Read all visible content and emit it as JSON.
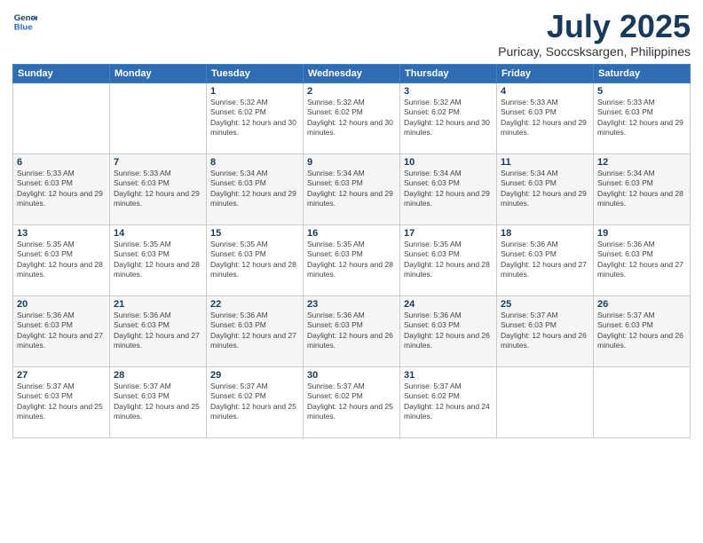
{
  "logo": {
    "line1": "General",
    "line2": "Blue"
  },
  "header": {
    "title": "July 2025",
    "subtitle": "Puricay, Soccsksargen, Philippines"
  },
  "weekdays": [
    "Sunday",
    "Monday",
    "Tuesday",
    "Wednesday",
    "Thursday",
    "Friday",
    "Saturday"
  ],
  "weeks": [
    [
      {
        "day": "",
        "info": ""
      },
      {
        "day": "",
        "info": ""
      },
      {
        "day": "1",
        "info": "Sunrise: 5:32 AM\nSunset: 6:02 PM\nDaylight: 12 hours and 30 minutes."
      },
      {
        "day": "2",
        "info": "Sunrise: 5:32 AM\nSunset: 6:02 PM\nDaylight: 12 hours and 30 minutes."
      },
      {
        "day": "3",
        "info": "Sunrise: 5:32 AM\nSunset: 6:02 PM\nDaylight: 12 hours and 30 minutes."
      },
      {
        "day": "4",
        "info": "Sunrise: 5:33 AM\nSunset: 6:03 PM\nDaylight: 12 hours and 29 minutes."
      },
      {
        "day": "5",
        "info": "Sunrise: 5:33 AM\nSunset: 6:03 PM\nDaylight: 12 hours and 29 minutes."
      }
    ],
    [
      {
        "day": "6",
        "info": "Sunrise: 5:33 AM\nSunset: 6:03 PM\nDaylight: 12 hours and 29 minutes."
      },
      {
        "day": "7",
        "info": "Sunrise: 5:33 AM\nSunset: 6:03 PM\nDaylight: 12 hours and 29 minutes."
      },
      {
        "day": "8",
        "info": "Sunrise: 5:34 AM\nSunset: 6:03 PM\nDaylight: 12 hours and 29 minutes."
      },
      {
        "day": "9",
        "info": "Sunrise: 5:34 AM\nSunset: 6:03 PM\nDaylight: 12 hours and 29 minutes."
      },
      {
        "day": "10",
        "info": "Sunrise: 5:34 AM\nSunset: 6:03 PM\nDaylight: 12 hours and 29 minutes."
      },
      {
        "day": "11",
        "info": "Sunrise: 5:34 AM\nSunset: 6:03 PM\nDaylight: 12 hours and 29 minutes."
      },
      {
        "day": "12",
        "info": "Sunrise: 5:34 AM\nSunset: 6:03 PM\nDaylight: 12 hours and 28 minutes."
      }
    ],
    [
      {
        "day": "13",
        "info": "Sunrise: 5:35 AM\nSunset: 6:03 PM\nDaylight: 12 hours and 28 minutes."
      },
      {
        "day": "14",
        "info": "Sunrise: 5:35 AM\nSunset: 6:03 PM\nDaylight: 12 hours and 28 minutes."
      },
      {
        "day": "15",
        "info": "Sunrise: 5:35 AM\nSunset: 6:03 PM\nDaylight: 12 hours and 28 minutes."
      },
      {
        "day": "16",
        "info": "Sunrise: 5:35 AM\nSunset: 6:03 PM\nDaylight: 12 hours and 28 minutes."
      },
      {
        "day": "17",
        "info": "Sunrise: 5:35 AM\nSunset: 6:03 PM\nDaylight: 12 hours and 28 minutes."
      },
      {
        "day": "18",
        "info": "Sunrise: 5:36 AM\nSunset: 6:03 PM\nDaylight: 12 hours and 27 minutes."
      },
      {
        "day": "19",
        "info": "Sunrise: 5:36 AM\nSunset: 6:03 PM\nDaylight: 12 hours and 27 minutes."
      }
    ],
    [
      {
        "day": "20",
        "info": "Sunrise: 5:36 AM\nSunset: 6:03 PM\nDaylight: 12 hours and 27 minutes."
      },
      {
        "day": "21",
        "info": "Sunrise: 5:36 AM\nSunset: 6:03 PM\nDaylight: 12 hours and 27 minutes."
      },
      {
        "day": "22",
        "info": "Sunrise: 5:36 AM\nSunset: 6:03 PM\nDaylight: 12 hours and 27 minutes."
      },
      {
        "day": "23",
        "info": "Sunrise: 5:36 AM\nSunset: 6:03 PM\nDaylight: 12 hours and 26 minutes."
      },
      {
        "day": "24",
        "info": "Sunrise: 5:36 AM\nSunset: 6:03 PM\nDaylight: 12 hours and 26 minutes."
      },
      {
        "day": "25",
        "info": "Sunrise: 5:37 AM\nSunset: 6:03 PM\nDaylight: 12 hours and 26 minutes."
      },
      {
        "day": "26",
        "info": "Sunrise: 5:37 AM\nSunset: 6:03 PM\nDaylight: 12 hours and 26 minutes."
      }
    ],
    [
      {
        "day": "27",
        "info": "Sunrise: 5:37 AM\nSunset: 6:03 PM\nDaylight: 12 hours and 25 minutes."
      },
      {
        "day": "28",
        "info": "Sunrise: 5:37 AM\nSunset: 6:03 PM\nDaylight: 12 hours and 25 minutes."
      },
      {
        "day": "29",
        "info": "Sunrise: 5:37 AM\nSunset: 6:02 PM\nDaylight: 12 hours and 25 minutes."
      },
      {
        "day": "30",
        "info": "Sunrise: 5:37 AM\nSunset: 6:02 PM\nDaylight: 12 hours and 25 minutes."
      },
      {
        "day": "31",
        "info": "Sunrise: 5:37 AM\nSunset: 6:02 PM\nDaylight: 12 hours and 24 minutes."
      },
      {
        "day": "",
        "info": ""
      },
      {
        "day": "",
        "info": ""
      }
    ]
  ]
}
